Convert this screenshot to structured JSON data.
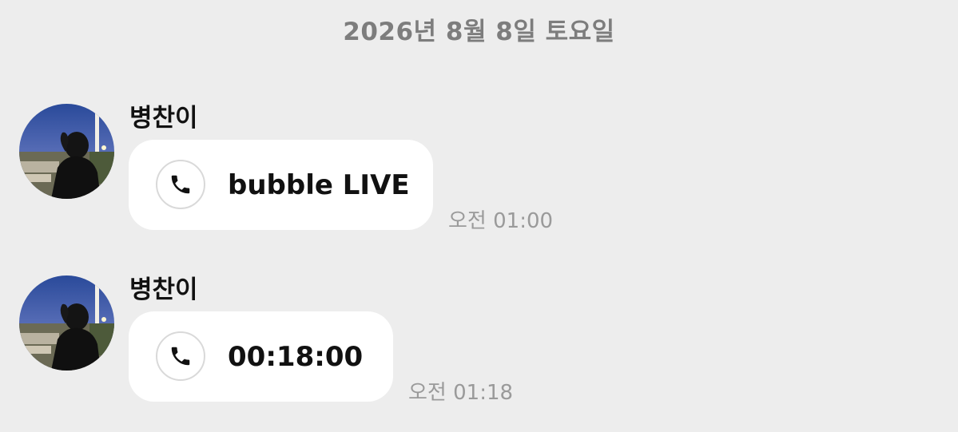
{
  "date_divider": "2026년 8월 8일 토요일",
  "messages": [
    {
      "sender": "병찬이",
      "icon": "phone-icon",
      "text": "bubble LIVE",
      "time": "오전 01:00"
    },
    {
      "sender": "병찬이",
      "icon": "phone-icon",
      "text": "00:18:00",
      "time": "오전 01:18"
    }
  ],
  "colors": {
    "background": "#ededed",
    "bubble": "#ffffff",
    "date_text": "#7d7d7d",
    "time_text": "#9a9a9a"
  }
}
